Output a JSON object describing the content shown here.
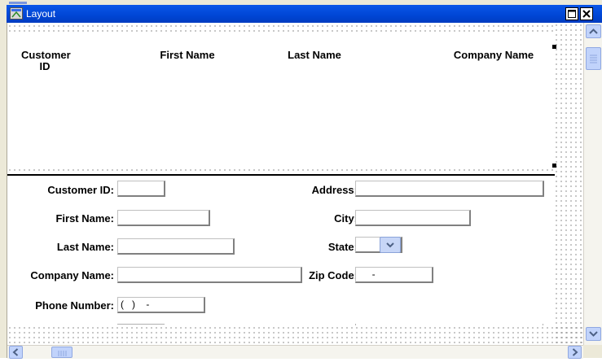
{
  "window": {
    "title": "Layout",
    "icon": "form-layout-icon"
  },
  "titlebar_buttons": [
    {
      "name": "maximize",
      "icon": "maximize-icon"
    },
    {
      "name": "close",
      "icon": "close-icon"
    }
  ],
  "header": {
    "columns": [
      {
        "line1": "Customer",
        "line2": "ID"
      },
      {
        "line1": "First Name",
        "line2": ""
      },
      {
        "line1": "Last Name",
        "line2": ""
      },
      {
        "line1": "Company Name",
        "line2": ""
      }
    ]
  },
  "form": {
    "customer_id": {
      "label": "Customer ID:",
      "value": ""
    },
    "first_name": {
      "label": "First Name:",
      "value": ""
    },
    "last_name": {
      "label": "Last Name:",
      "value": ""
    },
    "company_name": {
      "label": "Company Name:",
      "value": ""
    },
    "phone_number": {
      "label": "Phone Number:",
      "value": "(   )    -"
    },
    "address": {
      "label": "Address:",
      "value": ""
    },
    "city": {
      "label": "City:",
      "value": ""
    },
    "state": {
      "label": "State:",
      "value": ""
    },
    "zip_code": {
      "label": "Zip Code:",
      "value": "     -"
    }
  },
  "icons": {
    "combo_arrow": "chevron-down-icon",
    "scroll_up": "arrow-up-icon",
    "scroll_down": "arrow-down-icon",
    "scroll_left": "arrow-left-icon",
    "scroll_right": "arrow-right-icon"
  },
  "colors": {
    "titlebar": "#0046d5",
    "scroll_accent": "#c1d3fb",
    "frame": "#ece9d8"
  }
}
